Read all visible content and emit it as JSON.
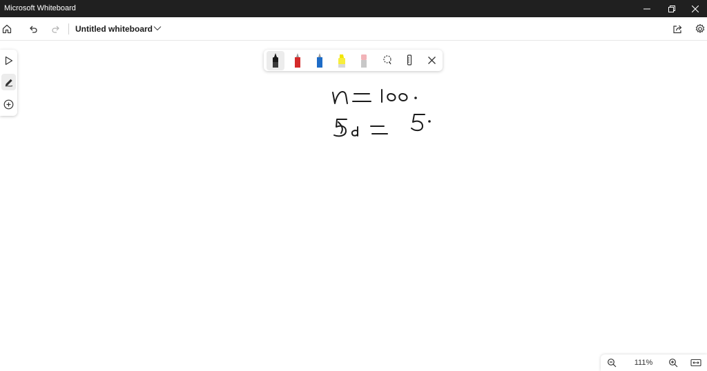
{
  "window": {
    "title": "Microsoft Whiteboard",
    "controls": [
      "minimize-icon",
      "restore-icon",
      "close-icon"
    ]
  },
  "toolbar": {
    "home_icon": "home-icon",
    "undo_icon": "undo-icon",
    "redo_icon": "redo-icon",
    "document_title": "Untitled whiteboard",
    "title_menu_icon": "chevron-down-icon",
    "share_icon": "share-icon",
    "settings_icon": "gear-icon"
  },
  "left_rail": {
    "items": [
      {
        "name": "select-tool",
        "icon": "pointer-icon"
      },
      {
        "name": "inking-tool",
        "icon": "pen-icon",
        "active": true
      },
      {
        "name": "create-tool",
        "icon": "plus-circle-icon"
      }
    ]
  },
  "pen_tray": {
    "pens": [
      {
        "name": "black-pen",
        "color": "#1a1a1a",
        "active": true
      },
      {
        "name": "red-pen",
        "color": "#d42a2a"
      },
      {
        "name": "blue-pen",
        "color": "#1e6cc7"
      },
      {
        "name": "yellow-highlighter",
        "color": "#f2e500"
      },
      {
        "name": "eraser",
        "color": "#f2b3b8"
      }
    ],
    "tools": [
      "lasso-select-icon",
      "ruler-icon",
      "close-icon"
    ]
  },
  "canvas": {
    "ink": [
      "n = 100.",
      "Sd = 5."
    ],
    "ink_color": "#1a1a1a"
  },
  "zoom": {
    "level": "111%",
    "zoom_out_icon": "zoom-out-icon",
    "zoom_in_icon": "zoom-in-icon",
    "fit_icon": "fit-to-screen-icon"
  }
}
